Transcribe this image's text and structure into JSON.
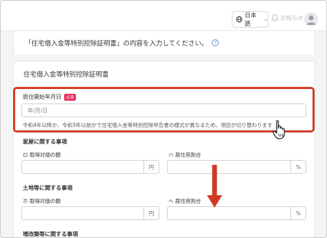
{
  "header": {
    "language_label": "日本語",
    "notice_label": "お知らせ"
  },
  "intro": {
    "text": "「住宅借入金等特別控除証明書」の内容を入力してください。",
    "help_symbol": "?"
  },
  "card": {
    "title": "住宅借入金等特別控除証明書",
    "move_in_date": {
      "label": "居住開始年月日",
      "required_badge": "必須",
      "placeholder": "年/月/日",
      "note": "令和4年以降か、令和3年以前かで住宅借入金等特別控除申告書の様式が異なるため、項目が切り替わります"
    },
    "house_section": {
      "title": "家屋に関する事項",
      "price_label": "ロ 取得対価の額",
      "price_unit": "円",
      "ratio_label": "ハ 居住用割合",
      "ratio_unit": "%"
    },
    "land_section": {
      "title": "土地等に関する事項",
      "price_label": "ホ 取得対価の額",
      "price_unit": "円",
      "ratio_label": "ヘ 居住用割合",
      "ratio_unit": "%"
    },
    "renovation_section": {
      "title": "増改築等に関する事項"
    }
  },
  "colors": {
    "highlight": "#d03a24",
    "required_badge": "#e8305a",
    "help_icon": "#5a8dd6"
  },
  "icons": {
    "language": "globe-icon",
    "notice": "bell-icon",
    "pointer": "hand-pointer-icon",
    "scroll_hint": "down-arrow-icon"
  }
}
